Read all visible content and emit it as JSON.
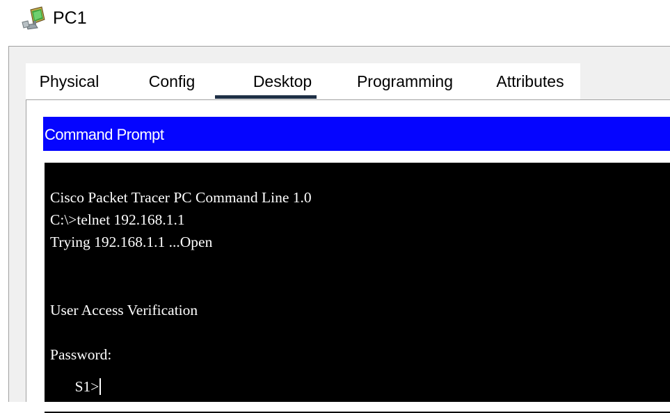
{
  "window": {
    "title": "PC1",
    "icon": "pc-monitor-icon"
  },
  "tabs": [
    {
      "label": "Physical",
      "active": false
    },
    {
      "label": "Config",
      "active": false
    },
    {
      "label": "Desktop",
      "active": true
    },
    {
      "label": "Programming",
      "active": false
    },
    {
      "label": "Attributes",
      "active": false
    }
  ],
  "command_prompt": {
    "header": "Command Prompt",
    "lines": [
      "Cisco Packet Tracer PC Command Line 1.0",
      "C:\\>telnet 192.168.1.1",
      "Trying 192.168.1.1 ...Open",
      "",
      "",
      "User Access Verification",
      "",
      "Password:"
    ],
    "prompt": "S1>"
  },
  "colors": {
    "header_bg": "#0505ff",
    "terminal_bg": "#000000",
    "terminal_fg": "#ffffff",
    "tab_underline": "#1f3046"
  }
}
